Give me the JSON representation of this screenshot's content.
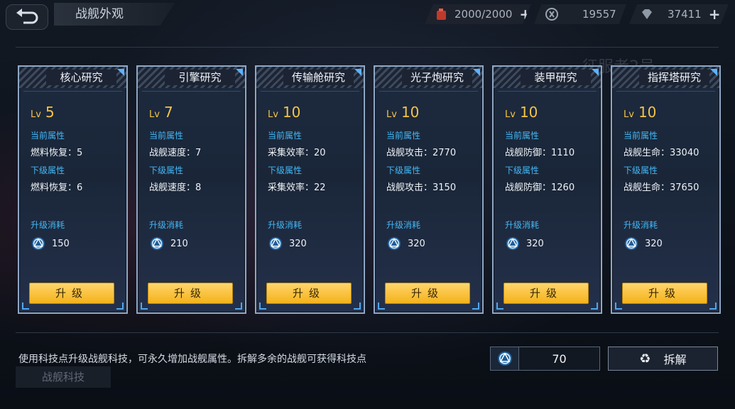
{
  "header": {
    "title": "战舰外观",
    "fuel": "2000/2000",
    "credits": "19557",
    "diamonds": "37411"
  },
  "background_text": [
    "征服者2号"
  ],
  "cards": [
    {
      "name": "核心研究",
      "lv_prefix": "Lv",
      "level": "5",
      "current_label": "当前属性",
      "current": "燃料恢复：5",
      "next_label": "下级属性",
      "next": "燃料恢复：6",
      "cost_label": "升级消耗",
      "cost": "150",
      "button": "升级"
    },
    {
      "name": "引擎研究",
      "lv_prefix": "Lv",
      "level": "7",
      "current_label": "当前属性",
      "current": "战舰速度：7",
      "next_label": "下级属性",
      "next": "战舰速度：8",
      "cost_label": "升级消耗",
      "cost": "210",
      "button": "升级"
    },
    {
      "name": "传输舱研究",
      "lv_prefix": "Lv",
      "level": "10",
      "current_label": "当前属性",
      "current": "采集效率：20",
      "next_label": "下级属性",
      "next": "采集效率：22",
      "cost_label": "升级消耗",
      "cost": "320",
      "button": "升级"
    },
    {
      "name": "光子炮研究",
      "lv_prefix": "Lv",
      "level": "10",
      "current_label": "当前属性",
      "current": "战舰攻击：2770",
      "next_label": "下级属性",
      "next": "战舰攻击：3150",
      "cost_label": "升级消耗",
      "cost": "320",
      "button": "升级"
    },
    {
      "name": "装甲研究",
      "lv_prefix": "Lv",
      "level": "10",
      "current_label": "当前属性",
      "current": "战舰防御：1110",
      "next_label": "下级属性",
      "next": "战舰防御：1260",
      "cost_label": "升级消耗",
      "cost": "320",
      "button": "升级"
    },
    {
      "name": "指挥塔研究",
      "lv_prefix": "Lv",
      "level": "10",
      "current_label": "当前属性",
      "current": "战舰生命：33040",
      "next_label": "下级属性",
      "next": "战舰生命：37650",
      "cost_label": "升级消耗",
      "cost": "320",
      "button": "升级"
    }
  ],
  "footer": {
    "hint": "使用科技点升级战舰科技，可永久增加战舰属性。拆解多余的战舰可获得科技点",
    "tech_tab": "战舰科技",
    "tech_points": "70",
    "dismantle": "拆解"
  },
  "colors": {
    "accent_gold": "#f3c447",
    "accent_blue": "#43b7f5",
    "button": "#f4b21a"
  },
  "icons": {
    "back": "back-arrow-icon",
    "fuel": "fuel-can-icon",
    "credits": "credit-icon",
    "diamond": "diamond-icon",
    "tech_point": "tech-point-icon",
    "recycle": "recycle-icon"
  }
}
